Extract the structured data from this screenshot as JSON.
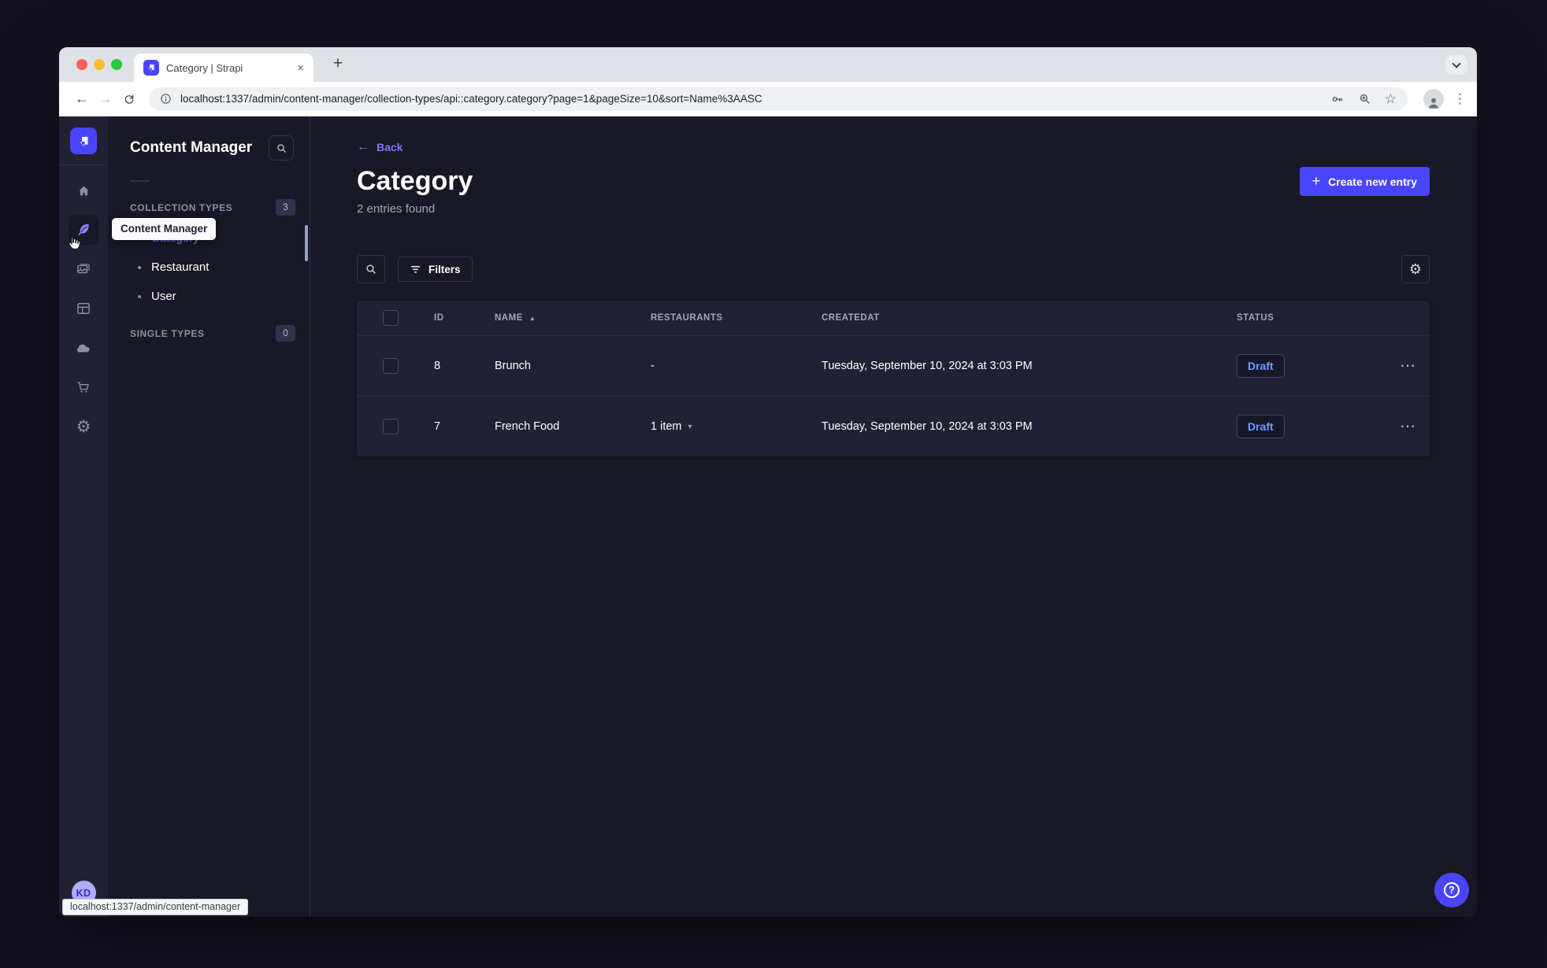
{
  "browser": {
    "tab_title": "Category | Strapi",
    "url": "localhost:1337/admin/content-manager/collection-types/api::category.category?page=1&pageSize=10&sort=Name%3AASC",
    "status_link": "localhost:1337/admin/content-manager"
  },
  "nav": {
    "tooltip": "Content Manager",
    "avatar_initials": "KD",
    "icons": [
      "home",
      "content-manager",
      "media-library",
      "content-type-builder",
      "cloud",
      "marketplace",
      "settings"
    ],
    "active_icon": "content-manager"
  },
  "subnav": {
    "title": "Content Manager",
    "search_icon": "search",
    "sections": [
      {
        "label": "COLLECTION TYPES",
        "badge": "3",
        "items": [
          {
            "label": "Category",
            "active": true
          },
          {
            "label": "Restaurant",
            "active": false
          },
          {
            "label": "User",
            "active": false
          }
        ]
      },
      {
        "label": "SINGLE TYPES",
        "badge": "0",
        "items": []
      }
    ]
  },
  "page": {
    "back_label": "Back",
    "title": "Category",
    "subtitle": "2 entries found",
    "create_button": "Create new entry"
  },
  "filters": {
    "label": "Filters"
  },
  "table": {
    "columns": [
      "ID",
      "NAME",
      "RESTAURANTS",
      "CREATEDAT",
      "STATUS"
    ],
    "sorted_column": "NAME",
    "sort_direction": "ASC",
    "rows": [
      {
        "id": "8",
        "name": "Brunch",
        "restaurants": "-",
        "created_at": "Tuesday, September 10, 2024 at 3:03 PM",
        "status": "Draft"
      },
      {
        "id": "7",
        "name": "French Food",
        "restaurants": "1 item",
        "created_at": "Tuesday, September 10, 2024 at 3:03 PM",
        "status": "Draft"
      }
    ]
  },
  "colors": {
    "primary": "#4945ff",
    "link": "#7b79ff",
    "draft_text": "#6c9ef8",
    "rail_bg": "#212134",
    "app_bg": "#181826",
    "card_bg": "#212134",
    "chrome_strip": "#dee1e6"
  }
}
